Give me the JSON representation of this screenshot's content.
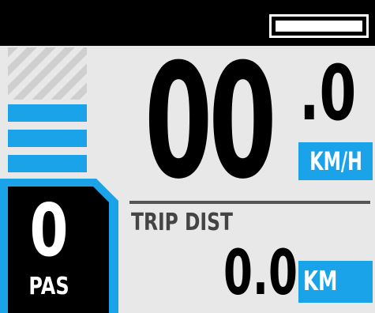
{
  "status_bar": {
    "battery_level": 1.0,
    "icon": "battery-icon"
  },
  "assist_gauge": {
    "icon": "assist-level-bars",
    "active_segments": 3,
    "total_segments": 5,
    "active_color": "#1aa3e8",
    "inactive_color": "#cfcfcf"
  },
  "pas": {
    "level": "0",
    "label": "PAS"
  },
  "speed": {
    "integer": "00",
    "decimal": ".0",
    "unit": "KM/H"
  },
  "trip": {
    "label": "TRIP DIST",
    "value": "0.0",
    "unit": "KM"
  },
  "colors": {
    "accent": "#1aa3e8",
    "background": "#e8e8e8",
    "bar": "#000000"
  }
}
